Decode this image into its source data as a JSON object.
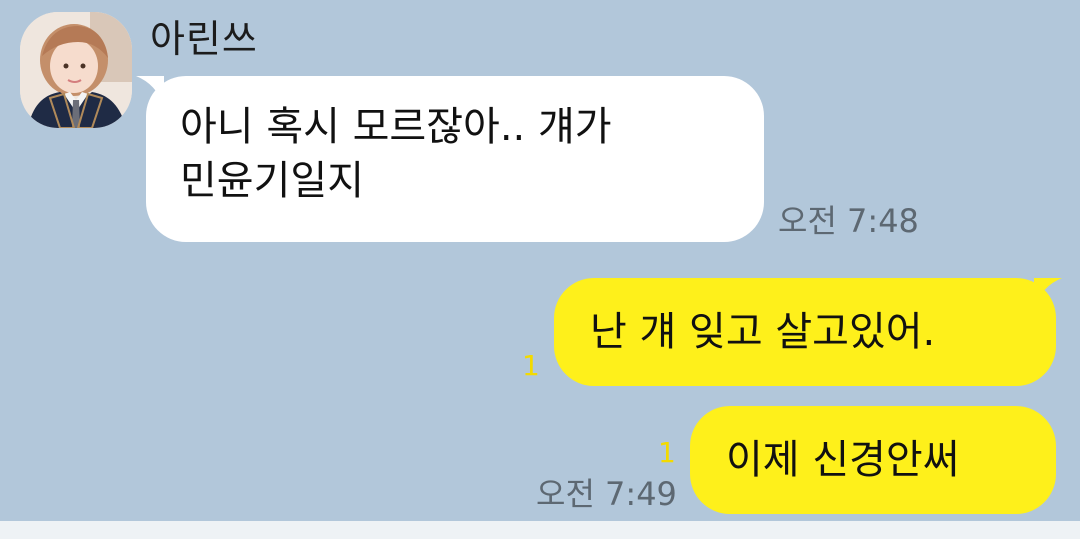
{
  "chat": {
    "sender_name": "아린쓰",
    "messages": [
      {
        "direction": "incoming",
        "lines": [
          "아니 혹시 모르잖아.. 걔가",
          "민윤기일지"
        ],
        "time": "오전 7:48"
      },
      {
        "direction": "outgoing",
        "text": "난 걔 잊고 살고있어.",
        "unread_count": "1"
      },
      {
        "direction": "outgoing",
        "text": "이제 신경안써",
        "unread_count": "1",
        "time": "오전 7:49"
      }
    ]
  },
  "colors": {
    "background": "#b2c7da",
    "incoming_bubble": "#ffffff",
    "outgoing_bubble": "#fef01b",
    "unread_badge": "#f3da00",
    "timestamp": "#5d6872"
  },
  "icons": {
    "avatar": "profile-photo"
  }
}
